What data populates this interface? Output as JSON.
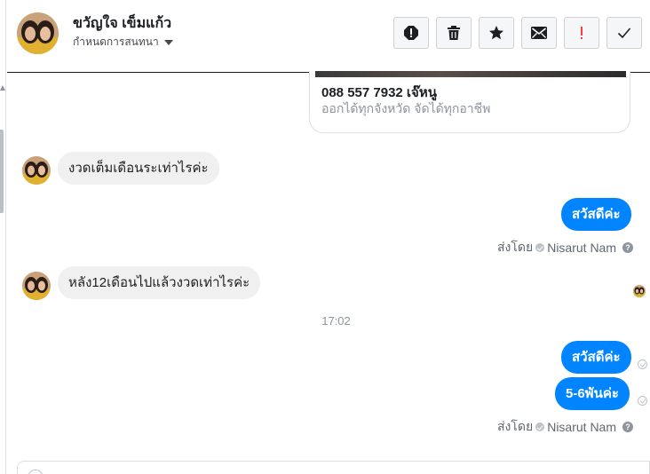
{
  "header": {
    "contact_name": "ขวัญใจ เข็มแก้ว",
    "conversation_settings_label": "กำหนดการสนทนา"
  },
  "toolbar": {
    "icons": [
      "spam-icon",
      "trash-icon",
      "star-icon",
      "mail-icon",
      "important-icon",
      "check-icon"
    ]
  },
  "link_preview": {
    "phone": "088 557 7932 เจ๊หนู",
    "description": "ออกได้ทุกจังหวัด จัดได้ทุกอาชีพ"
  },
  "messages": [
    {
      "direction": "in",
      "text": "งวดเต็มเดือนระเท่าไรค่ะ"
    },
    {
      "direction": "out",
      "text": "สวัสดีค่ะ"
    },
    {
      "direction": "in",
      "text": "หลัง12เดือนไปแล้วงวดเท่าไรค่ะ"
    },
    {
      "direction": "out",
      "text": "สวัสดีค่ะ"
    },
    {
      "direction": "out",
      "text": "5-6พันค่ะ"
    }
  ],
  "sent_by": {
    "prefix": "ส่งโดย",
    "agent_name": "Nisarut Nam"
  },
  "timestamp": "17:02",
  "colors": {
    "outgoing_bubble": "#0084ff",
    "incoming_bubble": "#f0f0f0",
    "important_icon": "#fa3e3e"
  }
}
